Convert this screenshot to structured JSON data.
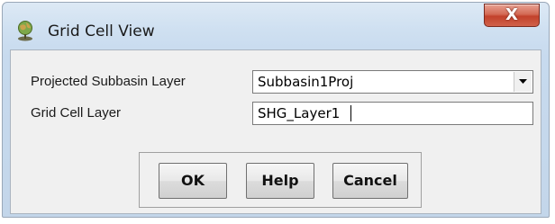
{
  "window": {
    "title": "Grid Cell View",
    "close_glyph": "X",
    "icon": "globe-pin-icon"
  },
  "form": {
    "subbasin_label": "Projected Subbasin Layer",
    "subbasin_value": "Subbasin1Proj",
    "gridcell_label": "Grid Cell Layer",
    "gridcell_value": "SHG_Layer1"
  },
  "buttons": {
    "ok": "OK",
    "help": "Help",
    "cancel": "Cancel"
  },
  "colors": {
    "close_button": "#c2412b",
    "dialog_background": "#f0f0f0",
    "titlebar": "#cfe0f1"
  }
}
